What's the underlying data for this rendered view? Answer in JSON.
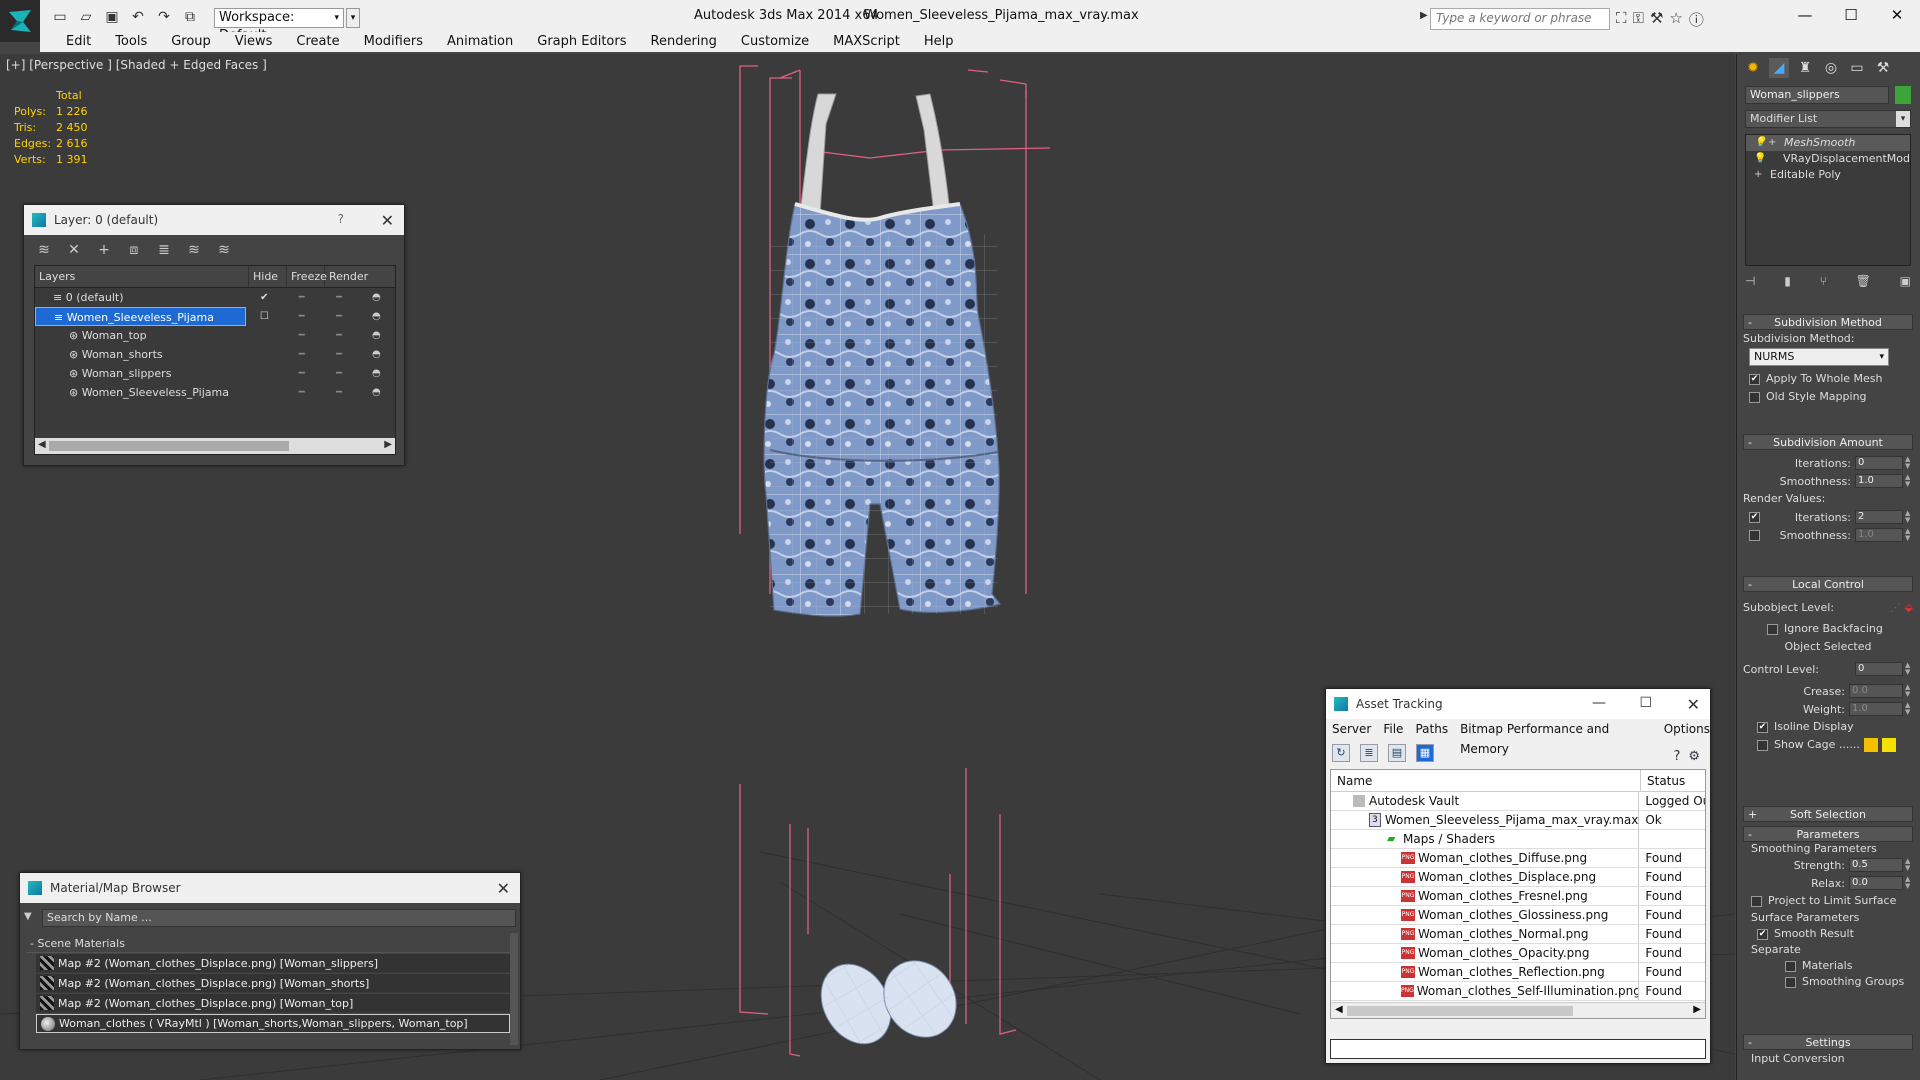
{
  "app": {
    "title": "Autodesk 3ds Max  2014 x64",
    "file": "Women_Sleeveless_Pijama_max_vray.max",
    "workspace": "Workspace: Default",
    "search_placeholder": "Type a keyword or phrase"
  },
  "menu": [
    "Edit",
    "Tools",
    "Group",
    "Views",
    "Create",
    "Modifiers",
    "Animation",
    "Graph Editors",
    "Rendering",
    "Customize",
    "MAXScript",
    "Help"
  ],
  "viewport": {
    "label": "[+] [Perspective ] [Shaded + Edged Faces ]",
    "stats": {
      "header": "Total",
      "rows": [
        {
          "k": "Polys:",
          "v": "1 226"
        },
        {
          "k": "Tris:",
          "v": "2 450"
        },
        {
          "k": "Edges:",
          "v": "2 616"
        },
        {
          "k": "Verts:",
          "v": "1 391"
        }
      ]
    }
  },
  "layer_window": {
    "title": "Layer: 0 (default)",
    "help": "?",
    "columns": [
      "Layers",
      "Hide",
      "Freeze",
      "Render"
    ],
    "rows": [
      {
        "name": "0 (default)"
      },
      {
        "name": "Women_Sleeveless_Pijama"
      },
      {
        "name": "Woman_top"
      },
      {
        "name": "Woman_shorts"
      },
      {
        "name": "Woman_slippers"
      },
      {
        "name": "Women_Sleeveless_Pijama"
      }
    ]
  },
  "material_browser": {
    "title": "Material/Map Browser",
    "search_placeholder": "Search by Name ...",
    "group": "Scene Materials",
    "items": [
      "Map #2 (Woman_clothes_Displace.png) [Woman_slippers]",
      "Map #2 (Woman_clothes_Displace.png) [Woman_shorts]",
      "Map #2 (Woman_clothes_Displace.png) [Woman_top]",
      "Woman_clothes  ( VRayMtl ) [Woman_shorts,Woman_slippers, Woman_top]"
    ]
  },
  "asset_tracking": {
    "title": "Asset Tracking",
    "menu": [
      "Server",
      "File",
      "Paths",
      "Bitmap Performance and Memory",
      "Options"
    ],
    "columns": [
      "Name",
      "Status"
    ],
    "rows": [
      {
        "name": "Autodesk Vault",
        "status": "Logged Ou"
      },
      {
        "name": "Women_Sleeveless_Pijama_max_vray.max",
        "status": "Ok"
      },
      {
        "name": "Maps / Shaders",
        "status": ""
      },
      {
        "name": "Woman_clothes_Diffuse.png",
        "status": "Found"
      },
      {
        "name": "Woman_clothes_Displace.png",
        "status": "Found"
      },
      {
        "name": "Woman_clothes_Fresnel.png",
        "status": "Found"
      },
      {
        "name": "Woman_clothes_Glossiness.png",
        "status": "Found"
      },
      {
        "name": "Woman_clothes_Normal.png",
        "status": "Found"
      },
      {
        "name": "Woman_clothes_Opacity.png",
        "status": "Found"
      },
      {
        "name": "Woman_clothes_Reflection.png",
        "status": "Found"
      },
      {
        "name": "Woman_clothes_Self-Illumination.png",
        "status": "Found"
      }
    ]
  },
  "command_panel": {
    "object_name": "Woman_slippers",
    "modifier_list": "Modifier List",
    "stack": [
      "MeshSmooth",
      "VRayDisplacementMod",
      "Editable Poly"
    ],
    "subdivision_method": {
      "rollout": "Subdivision Method",
      "label": "Subdivision Method:",
      "value": "NURMS",
      "apply_whole": "Apply To Whole Mesh",
      "old_style": "Old Style Mapping"
    },
    "subdivision_amount": {
      "rollout": "Subdivision Amount",
      "iterations_label": "Iterations:",
      "iterations": "0",
      "smoothness_label": "Smoothness:",
      "smoothness": "1.0",
      "render_values": "Render Values:",
      "r_iterations": "2",
      "r_smoothness": "1.0"
    },
    "local_control": {
      "rollout": "Local Control",
      "subobject": "Subobject Level:",
      "ignore_backfacing": "Ignore Backfacing",
      "object_selected": "Object Selected",
      "control_level_label": "Control Level:",
      "control_level": "0",
      "crease_label": "Crease:",
      "crease": "0.0",
      "weight_label": "Weight:",
      "weight": "1.0",
      "isoline": "Isoline Display",
      "show_cage": "Show Cage ......"
    },
    "soft_selection": "Soft Selection",
    "parameters": {
      "rollout": "Parameters",
      "smoothing_params": "Smoothing Parameters",
      "strength_label": "Strength:",
      "strength": "0.5",
      "relax_label": "Relax:",
      "relax": "0.0",
      "project_limit": "Project to Limit Surface",
      "surface_params": "Surface Parameters",
      "smooth_result": "Smooth Result",
      "separate": "Separate",
      "materials": "Materials",
      "smoothing_groups": "Smoothing Groups"
    },
    "settings": {
      "rollout": "Settings",
      "input_conversion": "Input Conversion"
    }
  },
  "colors": {
    "accent": "#1e6ad4",
    "stats": "#ffd200",
    "bbox": "#e06080",
    "object_color": "#3ba53b",
    "cage_1": "#f5c000",
    "cage_2": "#f5e000"
  }
}
